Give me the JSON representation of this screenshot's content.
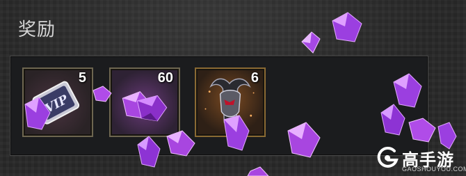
{
  "header": {
    "title": "奖励"
  },
  "rewards": {
    "items": [
      {
        "icon": "vip-card-icon",
        "count": "5"
      },
      {
        "icon": "purple-gem-icon",
        "count": "60"
      },
      {
        "icon": "demon-helmet-icon",
        "count": "6"
      }
    ]
  },
  "watermark": {
    "name": "高手游",
    "url": "GAOSHOUYOU.COM"
  },
  "colors": {
    "gem": "#9b3fe0",
    "gem_light": "#e2a8ff",
    "frame": "#6e6650",
    "frame_gold": "#8a6a33"
  }
}
